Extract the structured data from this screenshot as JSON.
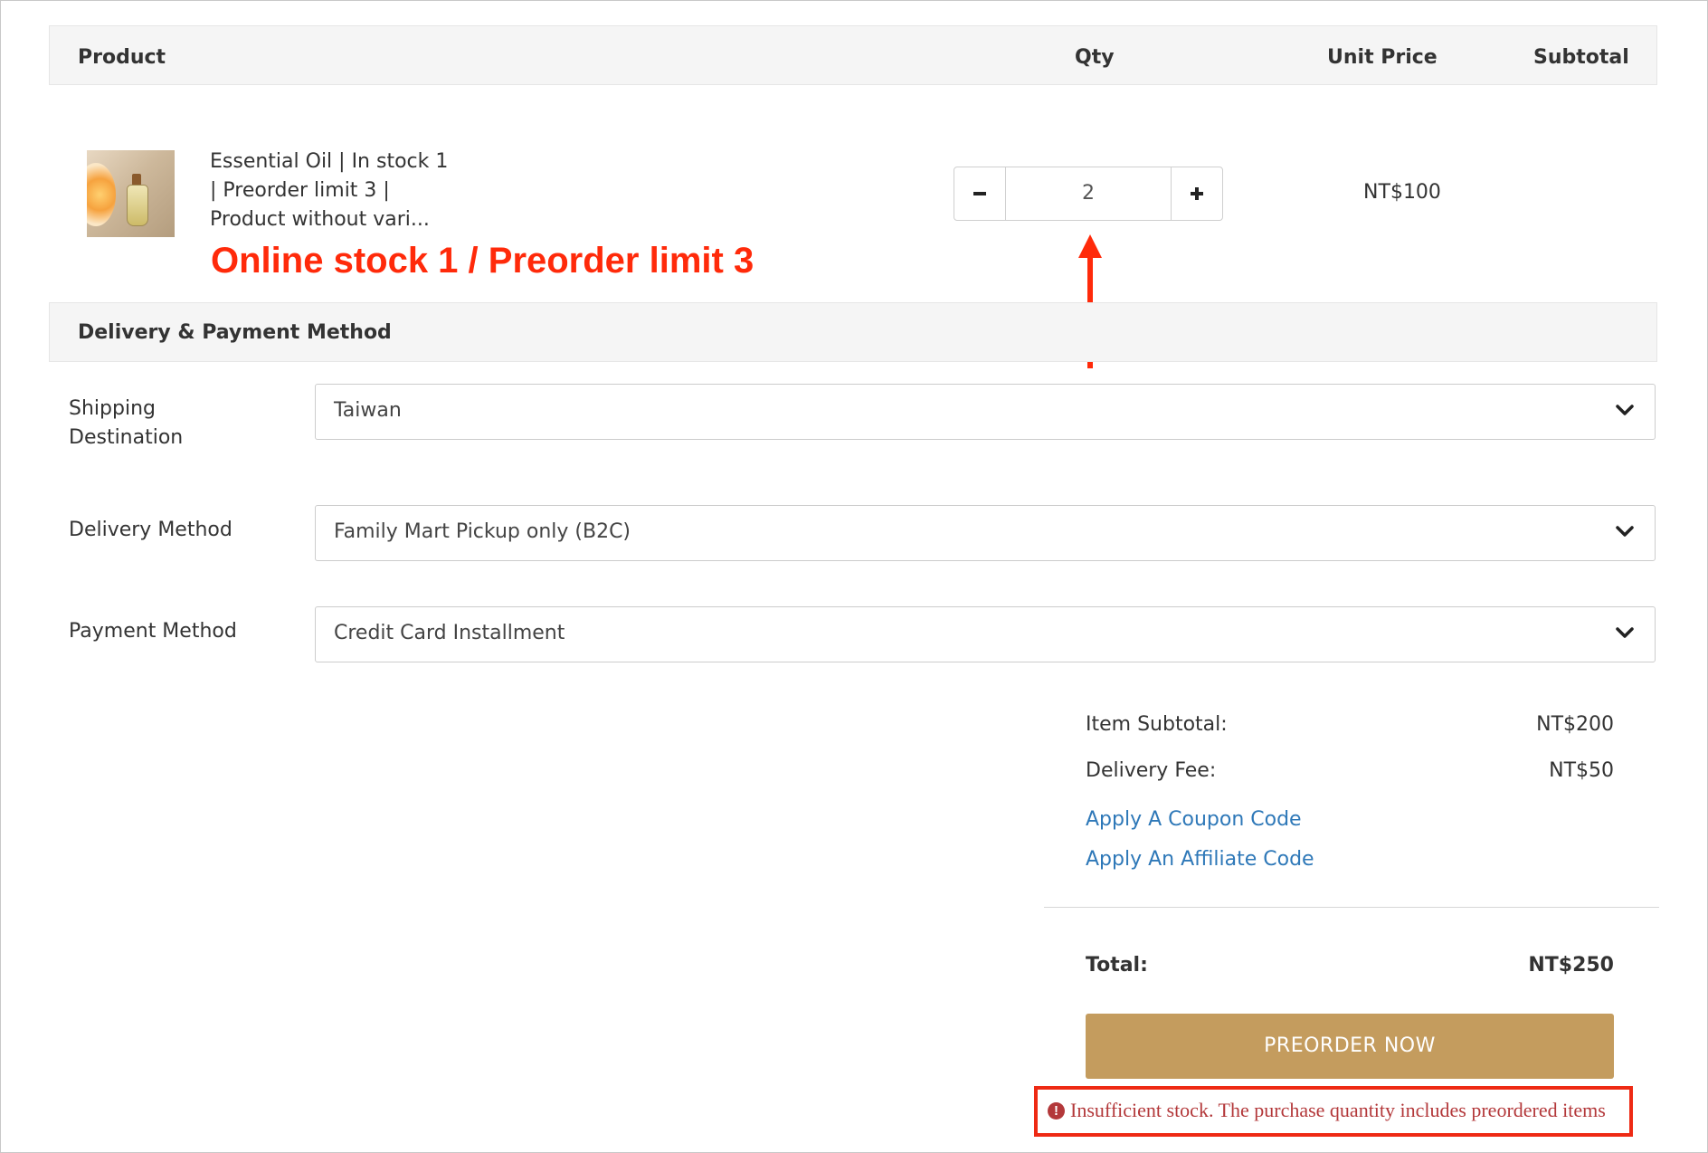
{
  "table_header": {
    "product": "Product",
    "qty": "Qty",
    "unit_price": "Unit Price",
    "subtotal": "Subtotal"
  },
  "product": {
    "name_line1": "Essential Oil | In stock 1",
    "name_line2": "| Preorder limit 3 |",
    "name_line3": "Product without vari...",
    "quantity": "2",
    "minus": "−",
    "plus": "+",
    "unit_price": "NT$100"
  },
  "annotation": {
    "text": "Online stock 1 / Preorder limit 3",
    "color": "#ff2a0a"
  },
  "delivery_section": {
    "title": "Delivery & Payment Method",
    "shipping_label_line1": "Shipping",
    "shipping_label_line2": "Destination",
    "shipping_value": "Taiwan",
    "delivery_label": "Delivery Method",
    "delivery_value": "Family Mart Pickup only (B2C)",
    "payment_label": "Payment Method",
    "payment_value": "Credit Card Installment"
  },
  "summary": {
    "item_subtotal_label": "Item Subtotal:",
    "item_subtotal_value": "NT$200",
    "delivery_fee_label": "Delivery Fee:",
    "delivery_fee_value": "NT$50",
    "coupon_link": "Apply A Coupon Code",
    "affiliate_link": "Apply An Affiliate Code",
    "total_label": "Total:",
    "total_value": "NT$250"
  },
  "checkout": {
    "button_label": "PREORDER NOW",
    "button_color": "#c49c5e",
    "error_message": "Insufficient stock. The purchase quantity includes preordered items",
    "error_icon": "!"
  }
}
